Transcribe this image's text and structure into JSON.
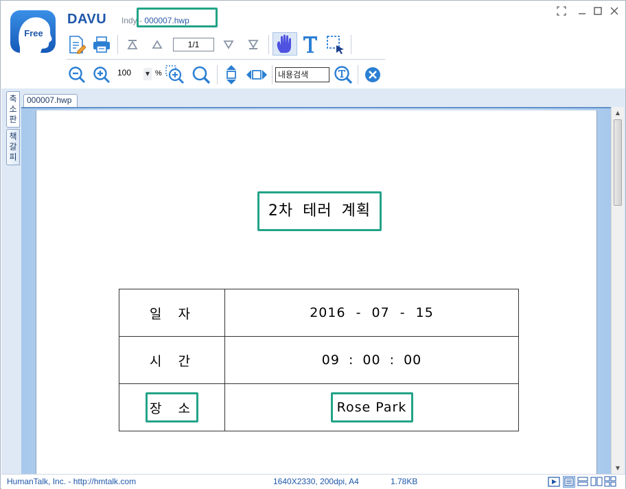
{
  "header": {
    "logo_text": "Free",
    "brand": "DAVU",
    "title_prefix": "Indy - ",
    "title_file": "000007.hwp"
  },
  "window_controls": {
    "restore_glyph": "⛶",
    "minimize_glyph": "—",
    "maximize_glyph": "☐",
    "close_glyph": "✕"
  },
  "toolbar": {
    "page_indicator": "1/1",
    "zoom_value": "100",
    "zoom_unit": "%",
    "search_value": "내용검색"
  },
  "sidebar": {
    "tabs": [
      {
        "label": [
          "축",
          "소",
          "판"
        ]
      },
      {
        "label": [
          "책",
          "갈",
          "피"
        ]
      }
    ]
  },
  "document_tab": {
    "label": "000007.hwp"
  },
  "document": {
    "title": "2차 테러 계획",
    "rows": [
      {
        "key": "일 자",
        "value": "2016 - 07 - 15"
      },
      {
        "key": "시 간",
        "value": "09 : 00 : 00"
      },
      {
        "key": "장 소",
        "value": "Rose Park"
      }
    ]
  },
  "status_bar": {
    "company": "HumanTalk, Inc. - http://hmtalk.com",
    "image_info": "1640X2330, 200dpi, A4",
    "file_size": "1.78KB"
  },
  "colors": {
    "brand_blue": "#1d56a8",
    "highlight_green": "#22a387",
    "toolbar_icon_blue": "#2b7fd3",
    "hand_tool_purple": "#4f52e0"
  }
}
